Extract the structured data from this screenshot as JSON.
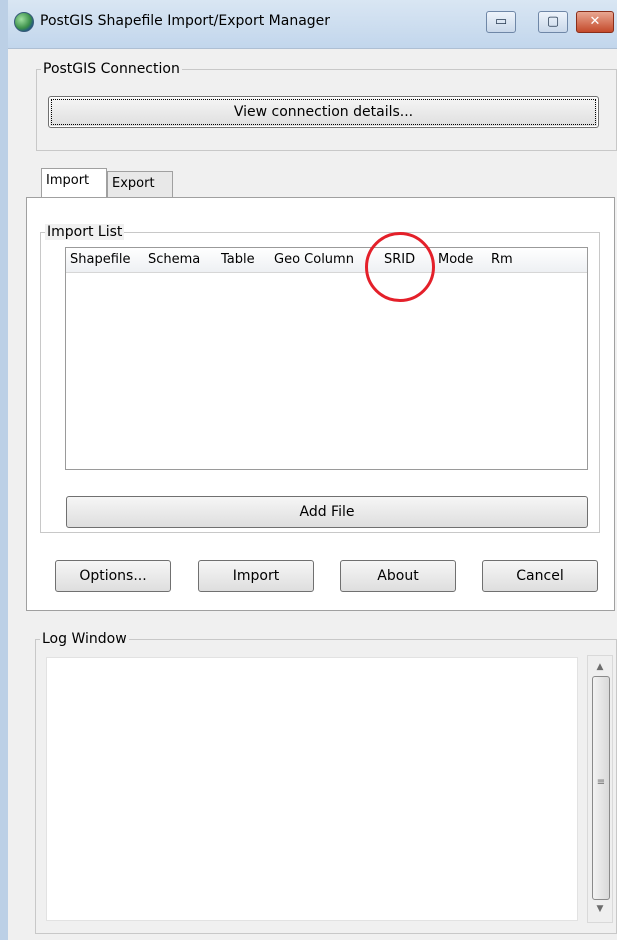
{
  "window": {
    "title": "PostGIS Shapefile Import/Export Manager",
    "controls": {
      "minimize_glyph": "▭",
      "maximize_glyph": "▢",
      "close_glyph": "✕"
    }
  },
  "connection": {
    "group_title": "PostGIS Connection",
    "view_details_label": "View connection details..."
  },
  "tabs": [
    {
      "label": "Import",
      "active": true
    },
    {
      "label": "Export",
      "active": false
    }
  ],
  "import_list": {
    "group_title": "Import List",
    "columns": [
      "Shapefile",
      "Schema",
      "Table",
      "Geo Column",
      "SRID",
      "Mode",
      "Rm"
    ],
    "rows": [],
    "add_file_label": "Add File"
  },
  "actions": {
    "options_label": "Options...",
    "import_label": "Import",
    "about_label": "About",
    "cancel_label": "Cancel"
  },
  "log": {
    "group_title": "Log Window",
    "text": "",
    "scroll_up_glyph": "▲",
    "scroll_down_glyph": "▼",
    "thumb_grip_glyph": "≡"
  },
  "colors": {
    "annotation_circle": "#e4202a",
    "close_button": "#c44a2b"
  }
}
